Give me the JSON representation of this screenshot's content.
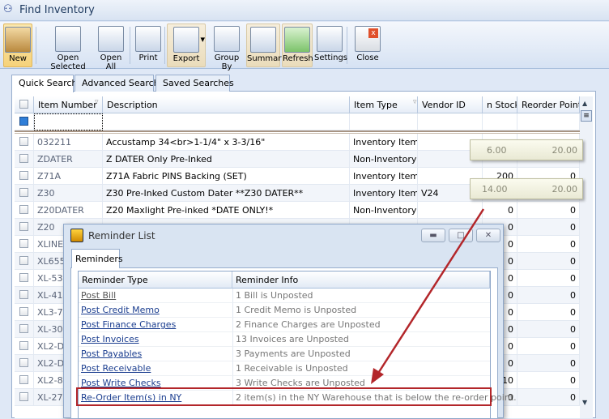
{
  "window": {
    "title": "Find Inventory",
    "icon": "binoculars-icon"
  },
  "toolbar": [
    {
      "id": "new",
      "label": "New",
      "icon": "new-box-icon"
    },
    {
      "id": "open-selected",
      "label": "Open Selected",
      "icon": "open-selected-icon"
    },
    {
      "id": "open-all",
      "label": "Open All",
      "icon": "open-all-icon"
    },
    {
      "id": "print",
      "label": "Print",
      "icon": "printer-icon"
    },
    {
      "id": "export",
      "label": "Export",
      "icon": "export-icon"
    },
    {
      "id": "group-by",
      "label": "Group By",
      "icon": "group-by-icon"
    },
    {
      "id": "summary",
      "label": "Summary",
      "icon": "summary-icon"
    },
    {
      "id": "refresh",
      "label": "Refresh",
      "icon": "refresh-icon"
    },
    {
      "id": "settings",
      "label": "Settings",
      "icon": "settings-icon"
    },
    {
      "id": "close",
      "label": "Close",
      "icon": "close-window-icon"
    }
  ],
  "tabs": [
    "Quick Search",
    "Advanced Search",
    "Saved Searches"
  ],
  "grid": {
    "columns": [
      "Item Number",
      "Description",
      "Item Type",
      "Vendor ID",
      "n Stock",
      "Reorder Point"
    ],
    "rows": [
      [
        "032211",
        "Accustamp 34<br>1-1/4\" x 3-3/16\"",
        "Inventory Item",
        "",
        "",
        ""
      ],
      [
        "ZDATER",
        "Z DATER Only  Pre-Inked",
        "Non-Inventory",
        "",
        "",
        ""
      ],
      [
        "Z71A",
        "Z71A  Fabric PINS Backing (SET)",
        "Inventory Item",
        "",
        "200",
        "0"
      ],
      [
        "Z30",
        "Z30  Pre-Inked Custom Dater **Z30 DATER**",
        "Inventory Item",
        "V24",
        "",
        ""
      ],
      [
        "Z20DATER",
        "Z20  Maxlight Pre-inked  *DATE ONLY!*",
        "Non-Inventory",
        "",
        "0",
        "0"
      ],
      [
        "Z20",
        "",
        "",
        "",
        "0",
        "0"
      ],
      [
        "XLINE",
        "",
        "",
        "",
        "0",
        "0"
      ],
      [
        "XL655-",
        "",
        "",
        "",
        "0",
        "0"
      ],
      [
        "XL-535",
        "",
        "",
        "",
        "0",
        "0"
      ],
      [
        "XL-414",
        "",
        "",
        "",
        "0",
        "0"
      ],
      [
        "XL3-72",
        "",
        "",
        "",
        "0",
        "0"
      ],
      [
        "XL-300",
        "",
        "",
        "",
        "0",
        "0"
      ],
      [
        "XL2-D3",
        "",
        "",
        "",
        "0",
        "0"
      ],
      [
        "XL2-D2",
        "",
        "",
        "",
        "0",
        "0"
      ],
      [
        "XL2-80",
        "",
        "",
        "",
        "10",
        "0"
      ],
      [
        "XL-277",
        "",
        "",
        "",
        "0",
        "0"
      ]
    ]
  },
  "tooltips": [
    {
      "stock": "6.00",
      "reorder": "20.00"
    },
    {
      "stock": "14.00",
      "reorder": "20.00"
    }
  ],
  "reminder": {
    "title": "Reminder List",
    "tab": "Reminders",
    "columns": [
      "Reminder Type",
      "Reminder Info"
    ],
    "rows": [
      [
        "Post Bill",
        "1 Bill is Unposted"
      ],
      [
        "Post Credit Memo",
        "1 Credit Memo is Unposted"
      ],
      [
        "Post Finance Charges",
        "2 Finance Charges are Unposted"
      ],
      [
        "Post Invoices",
        "13 Invoices are Unposted"
      ],
      [
        "Post Payables",
        "3 Payments are Unposted"
      ],
      [
        "Post Receivable",
        "1 Receivable is Unposted"
      ],
      [
        "Post Write Checks",
        "3 Write Checks are Unposted"
      ],
      [
        "Re-Order Item(s) in NY",
        "2 item(s) in the NY Warehouse that is below the re-order point."
      ]
    ],
    "highlighted_row": 7
  },
  "colors": {
    "highlight": "#b3262a",
    "link": "#1a3d8f",
    "arrow": "#b3262a"
  }
}
